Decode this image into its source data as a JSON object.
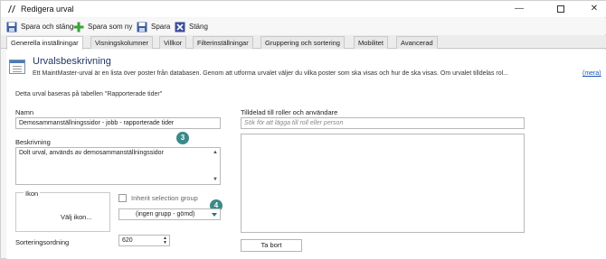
{
  "window": {
    "title": "Redigera urval",
    "controls": [
      "minimize-icon",
      "maximize-icon",
      "close-icon"
    ]
  },
  "toolbar": {
    "save_close": "Spara och stäng",
    "save_new": "Spara som ny",
    "save": "Spara",
    "close": "Stäng"
  },
  "tabs": [
    {
      "label": "Generella inställningar",
      "active": true
    },
    {
      "label": "Visningskolumner"
    },
    {
      "label": "Villkor"
    },
    {
      "label": "Filterinställningar"
    },
    {
      "label": "Gruppering och sortering"
    },
    {
      "label": "Mobilitet"
    },
    {
      "label": "Avancerad"
    }
  ],
  "header": {
    "title": "Urvalsbeskrivning",
    "description": "Ett MaintMaster-urval är en lista över poster från databasen. Genom att utforma urvalet väljer du vilka poster som ska visas och hur de ska visas. Om urvalet tilldelas rol...",
    "more": "(mera)"
  },
  "form": {
    "based_on": "Detta urval baseras på tabellen \"Rapporterade tider\"",
    "name_label": "Namn",
    "name_value": "Demosammanställningssidor - jobb - rapporterade tider",
    "description_label": "Beskrivning",
    "description_value": "Dolt urval, används av demosammanställningssidor",
    "icon_label": "Ikon",
    "choose_icon": "Välj ikon...",
    "inherit_group_label": "Inherit selection group",
    "inherit_group_checked": false,
    "group_value": "(ingen grupp - gömd)",
    "sort_label": "Sorteringsordning",
    "sort_value": "620"
  },
  "assigned": {
    "label": "Tilldelad till roller och användare",
    "search_placeholder": "Sök för att lägga till roll eller person",
    "remove_button": "Ta bort"
  },
  "badges": {
    "badge_3": "3",
    "badge_4": "4"
  },
  "colors": {
    "badge": "#3a8a8a",
    "link": "#1a57b8",
    "title": "#1f3763"
  }
}
